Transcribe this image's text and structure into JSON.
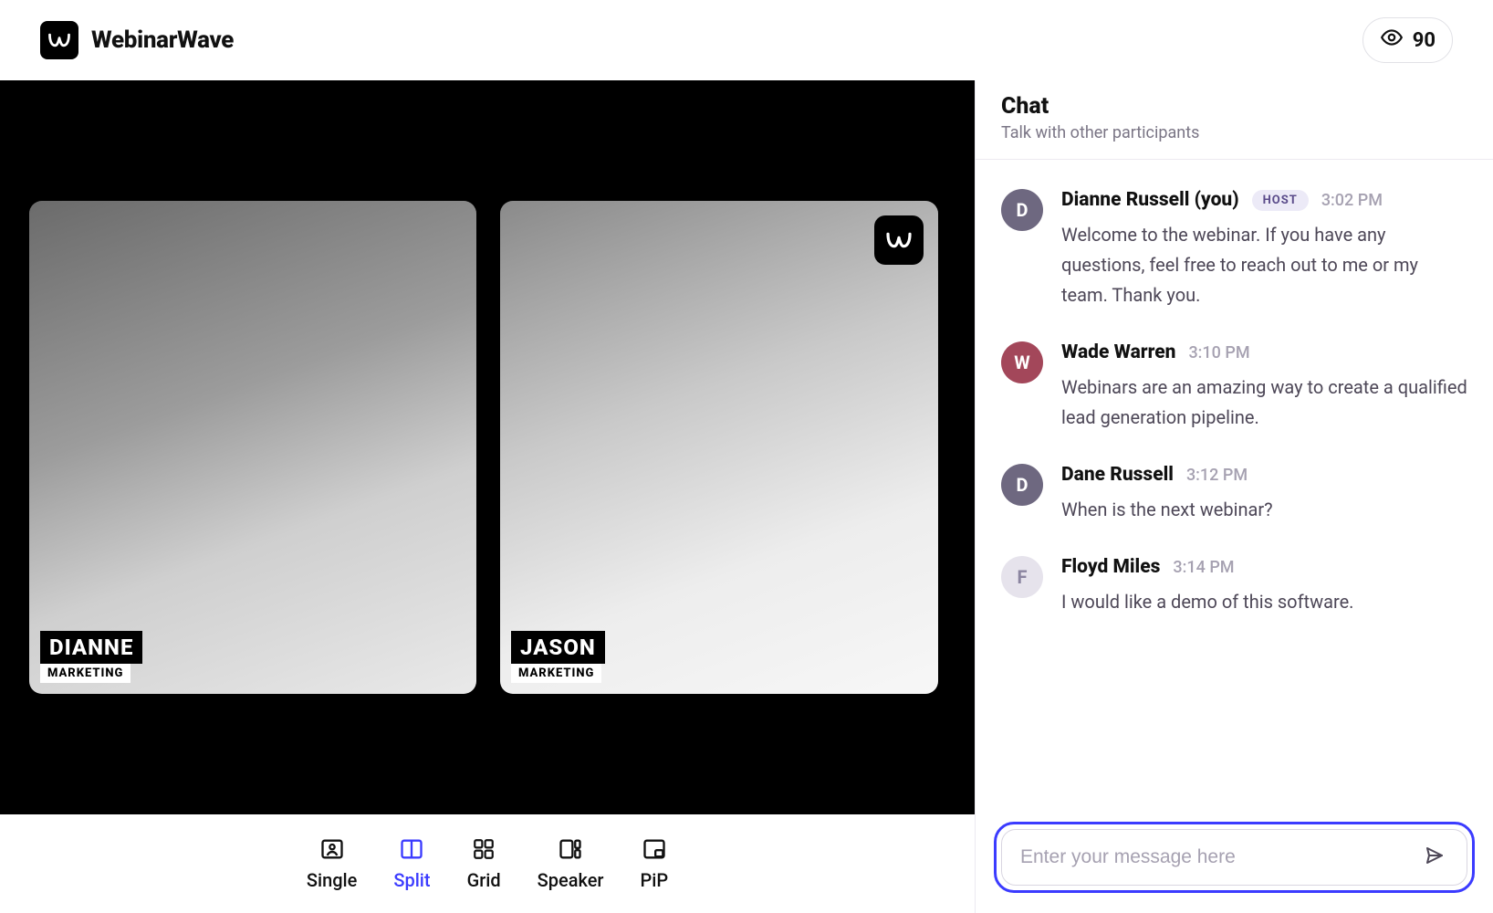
{
  "brand": {
    "name": "WebinarWave"
  },
  "viewers": {
    "count": "90"
  },
  "tiles": [
    {
      "name": "DIANNE",
      "role": "MARKETING"
    },
    {
      "name": "JASON",
      "role": "MARKETING"
    }
  ],
  "viewModes": {
    "single": "Single",
    "split": "Split",
    "grid": "Grid",
    "speaker": "Speaker",
    "pip": "PiP",
    "active": "split"
  },
  "chat": {
    "title": "Chat",
    "subtitle": "Talk with other participants",
    "hostLabel": "HOST",
    "compose": {
      "placeholder": "Enter your message here"
    },
    "messages": [
      {
        "initial": "D",
        "avatarColor": "#6e6880",
        "name": "Dianne Russell (you)",
        "host": true,
        "time": "3:02 PM",
        "text": "Welcome to the webinar. If you have any questions, feel free to reach out to me or my team. Thank you."
      },
      {
        "initial": "W",
        "avatarColor": "#a3475a",
        "name": "Wade Warren",
        "host": false,
        "time": "3:10 PM",
        "text": "Webinars are an amazing way to create a qualified lead generation pipeline."
      },
      {
        "initial": "D",
        "avatarColor": "#6e6880",
        "name": "Dane Russell",
        "host": false,
        "time": "3:12 PM",
        "text": "When is the next webinar?"
      },
      {
        "initial": "F",
        "avatarColor": "#e6e3ec",
        "name": "Floyd Miles",
        "host": false,
        "time": "3:14 PM",
        "text": "I would like a demo of this software."
      }
    ]
  }
}
